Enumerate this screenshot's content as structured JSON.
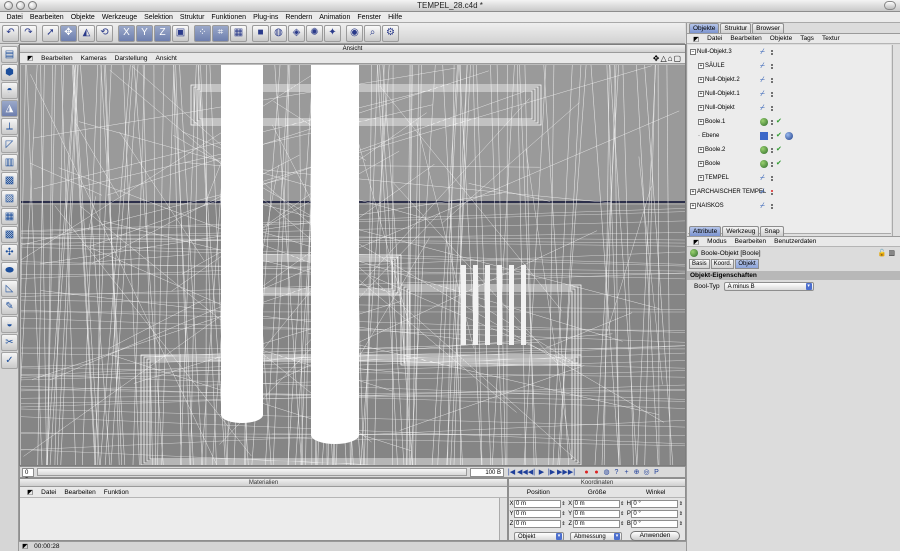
{
  "window": {
    "title": "TEMPEL_28.c4d *"
  },
  "menubar": [
    "Datei",
    "Bearbeiten",
    "Objekte",
    "Werkzeuge",
    "Selektion",
    "Struktur",
    "Funktionen",
    "Plug-ins",
    "Rendern",
    "Animation",
    "Fenster",
    "Hilfe"
  ],
  "toolbar": {
    "buttons": [
      {
        "icon": "undo-icon",
        "glyph": "↶"
      },
      {
        "icon": "redo-icon",
        "glyph": "↷"
      },
      {
        "icon": "select-pointer-icon",
        "glyph": "➚"
      },
      {
        "icon": "move-icon",
        "glyph": "✥",
        "selected": true
      },
      {
        "icon": "scale-icon",
        "glyph": "◭"
      },
      {
        "icon": "rotate-icon",
        "glyph": "⟲"
      },
      {
        "icon": "x-axis-icon",
        "glyph": "X",
        "selected": true
      },
      {
        "icon": "y-axis-icon",
        "glyph": "Y",
        "selected": true
      },
      {
        "icon": "z-axis-icon",
        "glyph": "Z",
        "selected": true
      },
      {
        "icon": "coord-system-icon",
        "glyph": "▣"
      },
      {
        "icon": "points-mode-icon",
        "glyph": "⁘",
        "selected": true
      },
      {
        "icon": "edges-mode-icon",
        "glyph": "⌗",
        "selected": true
      },
      {
        "icon": "polygons-mode-icon",
        "glyph": "▦"
      },
      {
        "icon": "cube-icon",
        "glyph": "■"
      },
      {
        "icon": "nurbs-icon",
        "glyph": "◍"
      },
      {
        "icon": "deformer-icon",
        "glyph": "◈"
      },
      {
        "icon": "scene-icon",
        "glyph": "✺"
      },
      {
        "icon": "light-icon",
        "glyph": "✦"
      },
      {
        "icon": "render-icon",
        "glyph": "◉"
      },
      {
        "icon": "render-view-icon",
        "glyph": "⌕"
      },
      {
        "icon": "render-settings-icon",
        "glyph": "⚙"
      }
    ]
  },
  "lefttools": [
    {
      "icon": "model-tool-icon",
      "glyph": "▤"
    },
    {
      "icon": "object-tool-icon",
      "glyph": "⬢"
    },
    {
      "icon": "texture-tool-icon",
      "glyph": "◓"
    },
    {
      "icon": "axis-tool-icon",
      "glyph": "◮",
      "selected": true
    },
    {
      "icon": "points-tool-icon",
      "glyph": "⟂"
    },
    {
      "icon": "edge-tool-icon",
      "glyph": "◸"
    },
    {
      "icon": "polygon-tool-icon",
      "glyph": "▥"
    },
    {
      "icon": "uv-points-icon",
      "glyph": "▩"
    },
    {
      "icon": "uv-polygons-icon",
      "glyph": "▨"
    },
    {
      "icon": "checker-icon",
      "glyph": "▦"
    },
    {
      "icon": "checker-2-icon",
      "glyph": "▩"
    },
    {
      "icon": "bones-icon",
      "glyph": "✣"
    },
    {
      "icon": "pose-icon",
      "glyph": "⬬"
    },
    {
      "icon": "graph-icon",
      "glyph": "◺"
    },
    {
      "icon": "paint-icon",
      "glyph": "✎"
    },
    {
      "icon": "sculpt-icon",
      "glyph": "◒"
    },
    {
      "icon": "hair-icon",
      "glyph": "✂"
    },
    {
      "icon": "weight-icon",
      "glyph": "✓"
    }
  ],
  "viewport": {
    "title": "Ansicht",
    "menu": [
      "Bearbeiten",
      "Kameras",
      "Darstellung",
      "Ansicht"
    ],
    "nav_icons": "✥△⌂▢"
  },
  "timeline": {
    "start": "0 B",
    "end": "100 B",
    "controls": [
      "|◀",
      "◀◀",
      "◀|",
      "▶",
      "|▶",
      "▶▶",
      "▶|"
    ],
    "record": [
      "●",
      "●",
      "◍",
      "?",
      "+",
      "⊕",
      "◎",
      "P"
    ]
  },
  "material": {
    "title": "Materialien",
    "menu": [
      "Datei",
      "Bearbeiten",
      "Funktion"
    ]
  },
  "coords": {
    "title": "Koordinaten",
    "headers": [
      "Position",
      "Größe",
      "Winkel"
    ],
    "rows": [
      {
        "pos_label": "X",
        "pos": "0 m",
        "size_label": "X",
        "size": "0 m",
        "rot_label": "H",
        "rot": "0 °"
      },
      {
        "pos_label": "Y",
        "pos": "0 m",
        "size_label": "Y",
        "size": "0 m",
        "rot_label": "P",
        "rot": "0 °"
      },
      {
        "pos_label": "Z",
        "pos": "0 m",
        "size_label": "Z",
        "size": "0 m",
        "rot_label": "B",
        "rot": "0 °"
      }
    ],
    "mode": "Objekt",
    "size_mode": "Abmessung",
    "apply": "Anwenden"
  },
  "status": {
    "time": "00:00:28"
  },
  "objects_panel": {
    "tabs": [
      "Objekte",
      "Struktur",
      "Browser"
    ],
    "menu": [
      "Datei",
      "Bearbeiten",
      "Objekte",
      "Tags",
      "Textur"
    ],
    "items": [
      {
        "name": "Null-Objekt.3",
        "indent": 0,
        "expand": "−",
        "icon": "null",
        "tag": "dots"
      },
      {
        "name": "SÄULE",
        "indent": 1,
        "expand": "+",
        "icon": "null",
        "tag": "dots"
      },
      {
        "name": "Null-Objekt.2",
        "indent": 1,
        "expand": "+",
        "icon": "null",
        "tag": "dots"
      },
      {
        "name": "Null-Objekt.1",
        "indent": 1,
        "expand": "+",
        "icon": "null",
        "tag": "dots"
      },
      {
        "name": "Null-Objekt",
        "indent": 1,
        "expand": "+",
        "icon": "null",
        "tag": "dots"
      },
      {
        "name": "Boole.1",
        "indent": 1,
        "expand": "+",
        "icon": "bool",
        "tag": "check"
      },
      {
        "name": "Ebene",
        "indent": 1,
        "expand": "",
        "icon": "plane",
        "tag": "check-sphere"
      },
      {
        "name": "Boole.2",
        "indent": 1,
        "expand": "+",
        "icon": "bool",
        "tag": "check"
      },
      {
        "name": "Boole",
        "indent": 1,
        "expand": "+",
        "icon": "bool",
        "tag": "check"
      },
      {
        "name": "TEMPEL",
        "indent": 1,
        "expand": "+",
        "icon": "null",
        "tag": "dots"
      },
      {
        "name": "ARCHAISCHER TEMPEL",
        "indent": 0,
        "expand": "+",
        "icon": "null",
        "tag": "dots-red"
      },
      {
        "name": "NAISKOS",
        "indent": 0,
        "expand": "+",
        "icon": "null",
        "tag": "dots"
      }
    ]
  },
  "attributes_panel": {
    "tabs": [
      "Attribute",
      "Werkzeug",
      "Snap"
    ],
    "menu": [
      "Modus",
      "Bearbeiten",
      "Benutzerdaten"
    ],
    "object_label": "Boole-Objekt [Boole]",
    "subtabs": [
      "Basis",
      "Koord.",
      "Objekt"
    ],
    "group_title": "Objekt-Eigenschaften",
    "bool_type_label": "Bool-Typ",
    "bool_type_value": "A minus B"
  }
}
